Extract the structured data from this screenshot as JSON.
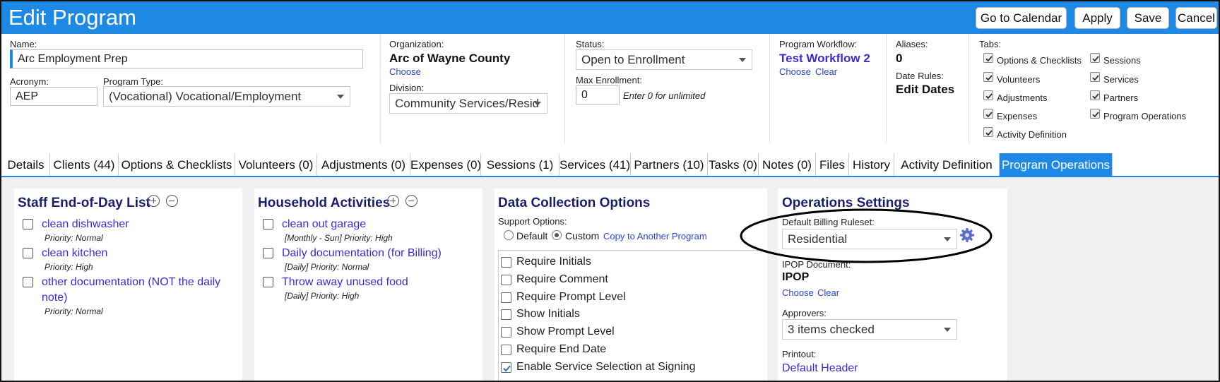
{
  "header": {
    "title": "Edit Program",
    "buttons": {
      "calendar": "Go to Calendar",
      "apply": "Apply",
      "save": "Save",
      "cancel": "Cancel"
    }
  },
  "form": {
    "name_label": "Name:",
    "name_value": "Arc Employment Prep",
    "acronym_label": "Acronym:",
    "acronym_value": "AEP",
    "program_type_label": "Program Type:",
    "program_type_value": "(Vocational) Vocational/Employment",
    "organization_label": "Organization:",
    "organization_value": "Arc of Wayne County",
    "organization_choose": "Choose",
    "division_label": "Division:",
    "division_value": "Community Services/Resid",
    "status_label": "Status:",
    "status_value": "Open to Enrollment",
    "max_enrollment_label": "Max Enrollment:",
    "max_enrollment_value": "0",
    "max_enrollment_hint": "Enter 0 for unlimited",
    "workflow_label": "Program Workflow:",
    "workflow_value": "Test Workflow 2",
    "workflow_choose": "Choose",
    "workflow_clear": "Clear",
    "aliases_label": "Aliases:",
    "aliases_value": "0",
    "date_rules_label": "Date Rules:",
    "date_rules_value": "Edit Dates",
    "tabs_label": "Tabs:",
    "tab_options": [
      {
        "label": "Options & Checklists",
        "checked": true
      },
      {
        "label": "Volunteers",
        "checked": true
      },
      {
        "label": "Adjustments",
        "checked": true
      },
      {
        "label": "Expenses",
        "checked": true
      },
      {
        "label": "Activity Definition",
        "checked": true
      },
      {
        "label": "Sessions",
        "checked": true
      },
      {
        "label": "Services",
        "checked": true
      },
      {
        "label": "Partners",
        "checked": true
      },
      {
        "label": "Program Operations",
        "checked": true
      }
    ]
  },
  "tabs": [
    "Details",
    "Clients (44)",
    "Options & Checklists",
    "Volunteers (0)",
    "Adjustments (0)",
    "Expenses (0)",
    "Sessions (1)",
    "Services (41)",
    "Partners (10)",
    "Tasks (0)",
    "Notes (0)",
    "Files",
    "History",
    "Activity Definition",
    "Program Operations"
  ],
  "staff_list": {
    "title": "Staff End-of-Day List",
    "items": [
      {
        "name": "clean dishwasher",
        "meta": "Priority: Normal"
      },
      {
        "name": "clean kitchen",
        "meta": "Priority: High"
      },
      {
        "name": "other documentation (NOT the daily note)",
        "meta": "Priority: Normal"
      }
    ]
  },
  "household": {
    "title": "Household Activities",
    "items": [
      {
        "name": "clean out garage",
        "meta": "[Monthly - Sun] Priority: High"
      },
      {
        "name": "Daily documentation (for Billing)",
        "meta": "[Daily] Priority: Normal"
      },
      {
        "name": "Throw away unused food",
        "meta": "[Daily] Priority: High"
      }
    ]
  },
  "data_collection": {
    "title": "Data Collection Options",
    "support_label": "Support Options:",
    "default_label": "Default",
    "custom_label": "Custom",
    "copy_link": "Copy to Another Program",
    "requirements": [
      {
        "label": "Require Initials",
        "checked": false
      },
      {
        "label": "Require Comment",
        "checked": false
      },
      {
        "label": "Require Prompt Level",
        "checked": false
      },
      {
        "label": "Show Initials",
        "checked": false
      },
      {
        "label": "Show Prompt Level",
        "checked": false
      },
      {
        "label": "Require End Date",
        "checked": false
      },
      {
        "label": "Enable Service Selection at Signing",
        "checked": true
      }
    ]
  },
  "operations": {
    "title": "Operations Settings",
    "billing_label": "Default Billing Ruleset:",
    "billing_value": "Residential",
    "ipop_label": "IPOP Document:",
    "ipop_value": "IPOP",
    "ipop_choose": "Choose",
    "ipop_clear": "Clear",
    "approvers_label": "Approvers:",
    "approvers_value": "3 items checked",
    "printout_label": "Printout:",
    "printout_header": "Default Header"
  }
}
